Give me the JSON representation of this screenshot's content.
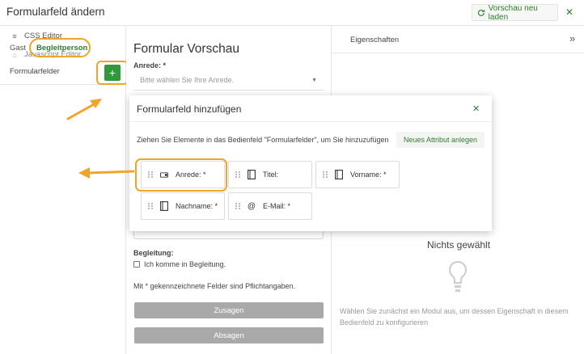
{
  "header": {
    "title": "Formularfeld ändern",
    "reload_label": "Vorschau neu laden"
  },
  "left": {
    "items": [
      {
        "label": "CSS Editor",
        "icon": "css3-icon"
      },
      {
        "label": "Javascript Editor",
        "icon": "js-icon"
      }
    ],
    "tabs": [
      "Gast",
      "Begleitperson"
    ],
    "formfelder_label": "Formularfelder",
    "plus_label": "+"
  },
  "preview": {
    "title": "Formular Vorschau",
    "anrede_label": "Anrede: *",
    "anrede_placeholder": "Bitte wählen Sie Ihre Anrede.",
    "begleitung_label": "Begleitung:",
    "begleitung_option": "Ich komme in Begleitung.",
    "pflicht_note": "Mit * gekennzeichnete Felder sind Pflichtangaben.",
    "zusagen_label": "Zusagen",
    "absagen_label": "Absagen"
  },
  "properties": {
    "title": "Eigenschaften",
    "toggle": "»",
    "nothing_selected": "Nichts gewählt",
    "hint": "Wählen Sie zunächst ein Modul aus, um dessen Eigenschaft in diesem Bedienfeld zu konfigurieren"
  },
  "modal": {
    "title": "Formularfeld hinzufügen",
    "hint": "Ziehen Sie Elemente in das Bedienfeld \"Formularfelder\", um Sie hinzuzufügen",
    "new_attr_label": "Neues Attribut anlegen",
    "fields": [
      {
        "label": "Anrede: *",
        "icon": "dropdown-icon"
      },
      {
        "label": "Titel:",
        "icon": "text-field-icon"
      },
      {
        "label": "Vorname: *",
        "icon": "text-field-icon"
      },
      {
        "label": "Nachname: *",
        "icon": "text-field-icon"
      },
      {
        "label": "E-Mail: *",
        "icon": "at-icon"
      }
    ]
  },
  "colors": {
    "accent_green": "#2f9a3a",
    "highlight_orange": "#f0a429",
    "disabled_button": "#a9a9a9"
  }
}
